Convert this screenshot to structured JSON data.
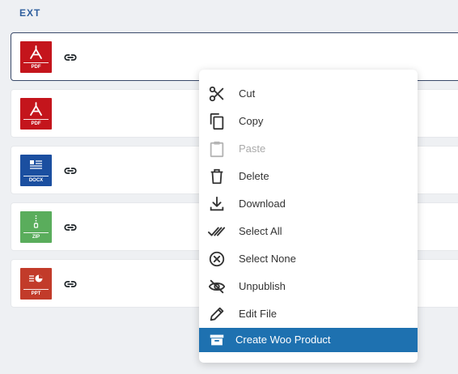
{
  "section": {
    "label": "EXT"
  },
  "files": [
    {
      "type": "pdf",
      "ext": "PDF",
      "color": "#c4151c",
      "has_link": true
    },
    {
      "type": "pdf",
      "ext": "PDF",
      "color": "#c4151c",
      "has_link": false
    },
    {
      "type": "docx",
      "ext": "DOCX",
      "color": "#1b4fa0",
      "has_link": true
    },
    {
      "type": "zip",
      "ext": "ZIP",
      "color": "#5aad5c",
      "has_link": true
    },
    {
      "type": "ppt",
      "ext": "PPT",
      "color": "#c23b2a",
      "has_link": true
    }
  ],
  "context_menu": {
    "highlight_color": "#1e71b0",
    "items": [
      {
        "label": "Cut",
        "icon": "scissors-icon",
        "disabled": false
      },
      {
        "label": "Copy",
        "icon": "copy-icon",
        "disabled": false
      },
      {
        "label": "Paste",
        "icon": "clipboard-icon",
        "disabled": true
      },
      {
        "label": "Delete",
        "icon": "trash-icon",
        "disabled": false
      },
      {
        "label": "Download",
        "icon": "download-icon",
        "disabled": false
      },
      {
        "label": "Select All",
        "icon": "double-check-icon",
        "disabled": false
      },
      {
        "label": "Select None",
        "icon": "circle-x-icon",
        "disabled": false
      },
      {
        "label": "Unpublish",
        "icon": "eye-off-icon",
        "disabled": false
      },
      {
        "label": "Edit File",
        "icon": "pencil-icon",
        "disabled": false
      },
      {
        "label": "Create Woo Product",
        "icon": "archive-box-icon",
        "disabled": false,
        "active": true
      }
    ]
  }
}
